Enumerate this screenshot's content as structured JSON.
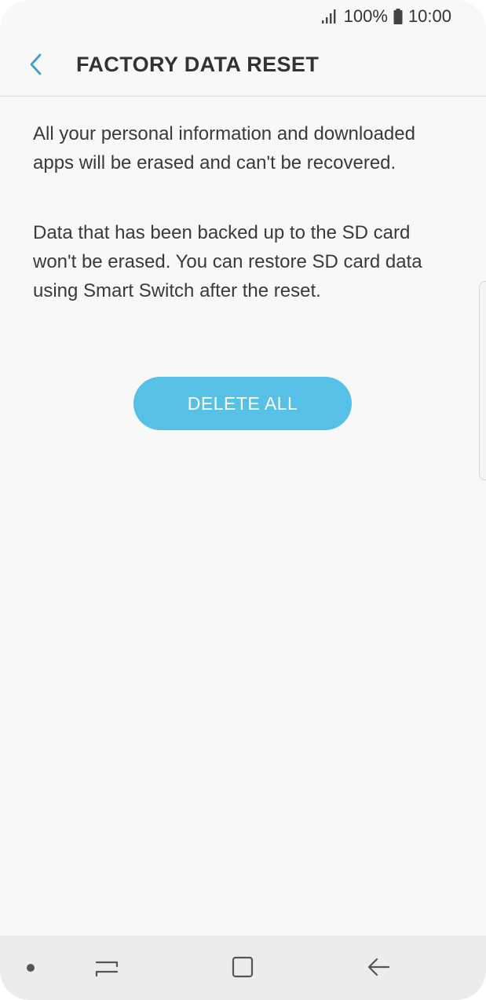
{
  "status_bar": {
    "battery_percent": "100%",
    "time": "10:00",
    "icons": [
      "signal-icon",
      "battery-icon"
    ]
  },
  "header": {
    "back_icon": "chevron-left-icon",
    "title": "FACTORY DATA RESET"
  },
  "content": {
    "paragraph_1": "All your personal information and downloaded apps will be erased and can't be recovered.",
    "paragraph_2": "Data that has been backed up to the SD card won't be erased. You can restore SD card data using Smart Switch after the reset.",
    "delete_button_label": "DELETE ALL"
  },
  "nav_bar": {
    "icons": [
      "dot-icon",
      "recents-icon",
      "home-icon",
      "back-arrow-icon"
    ]
  },
  "colors": {
    "background": "#f8f8f8",
    "accent": "#56c0e6",
    "back_chevron": "#3f9ecb",
    "text": "#333333",
    "nav_bar": "#ececec"
  }
}
